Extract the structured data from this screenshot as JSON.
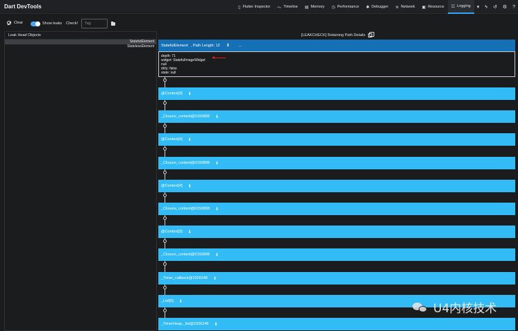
{
  "app": {
    "title": "Dart DevTools"
  },
  "tabs": [
    {
      "label": "Flutter Inspector",
      "icon": "phone-icon",
      "glyph": "▯"
    },
    {
      "label": "Timeline",
      "icon": "timeline-icon",
      "glyph": "〜"
    },
    {
      "label": "Memory",
      "icon": "memory-icon",
      "glyph": "▤"
    },
    {
      "label": "Performance",
      "icon": "performance-icon",
      "glyph": "◷"
    },
    {
      "label": "Debugger",
      "icon": "bug-icon",
      "glyph": "✱"
    },
    {
      "label": "Network",
      "icon": "network-icon",
      "glyph": "≋"
    },
    {
      "label": "Resource",
      "icon": "resource-icon",
      "glyph": "▣"
    },
    {
      "label": "Logging",
      "icon": "logging-icon",
      "glyph": "☷",
      "active": true
    }
  ],
  "tab_actions": [
    {
      "name": "more-dropdown-icon",
      "glyph": "▾"
    },
    {
      "name": "bolt-icon",
      "glyph": "ϟ"
    },
    {
      "name": "history-icon",
      "glyph": "↺"
    },
    {
      "name": "settings-icon",
      "glyph": "⚙"
    },
    {
      "name": "help-icon",
      "glyph": "?"
    }
  ],
  "toolbar": {
    "clear_label": "Clear",
    "show_leaks_label": "Show leaks",
    "show_leaks_on": true,
    "check_label": "Check!",
    "tag_placeholder": "Tag"
  },
  "left_panel": {
    "title": "Leak Head Objects",
    "items": [
      "StatefulElement",
      "StatelessElement"
    ],
    "selected_index": 0
  },
  "right_panel": {
    "title": "[LEAKCHECK] Retaining Path Details",
    "root": {
      "label": "StatefulElement",
      "path_length": ", Path Length: 12",
      "arrow": "⬇",
      "more": "..."
    },
    "details": [
      "depth: 71",
      "widget: StatefulImageWidget",
      "null",
      "dirty: false",
      "state: null"
    ],
    "path_nodes": [
      "@Context[3]",
      "_Closure_context@0150898",
      "@Context[4]",
      "_Closure_context@0150898",
      "@Context[4]",
      "_Closure_context@0150898",
      "@Context[3]",
      "_Closure_context@0150898",
      "_Timer_callback@1026248",
      "_List[0]",
      "_TimerHeap._list@1026248"
    ],
    "node_arrow": "⬇"
  },
  "colors": {
    "accent": "#36a3f7",
    "root_node": "#1670b5",
    "path_node": "#33bbf6",
    "background": "#1b1c1e",
    "annotation_arrow": "#e02020"
  },
  "watermark": {
    "text": "U4内核技术",
    "icon": "wechat-logo"
  }
}
